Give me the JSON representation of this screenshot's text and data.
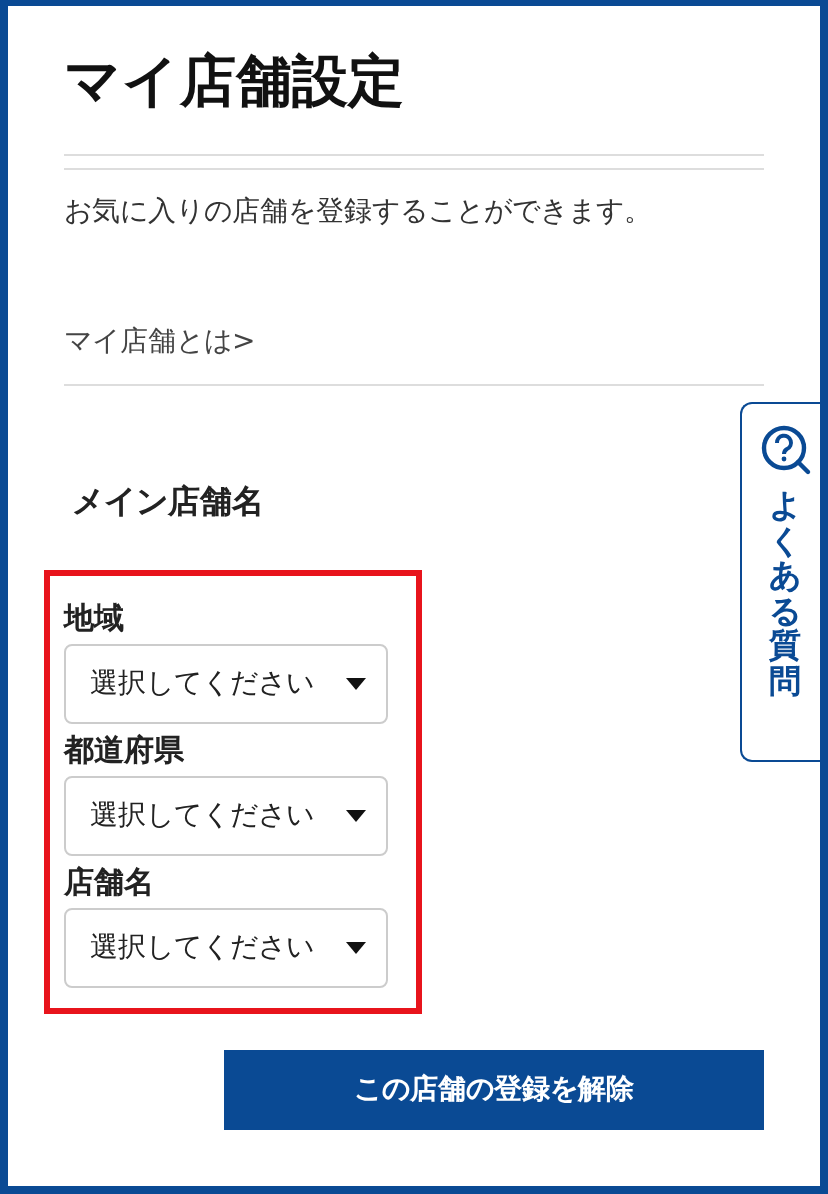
{
  "title": "マイ店舗設定",
  "description": "お気に入りの店舗を登録することができます。",
  "about_link": "マイ店舗とは>",
  "section_title": "メイン店舗名",
  "selects": [
    {
      "label": "地域",
      "value": "選択してください"
    },
    {
      "label": "都道府県",
      "value": "選択してください"
    },
    {
      "label": "店舗名",
      "value": "選択してください"
    }
  ],
  "unregister_button": "この店舗の登録を解除",
  "faq_tab": "よくある質問"
}
